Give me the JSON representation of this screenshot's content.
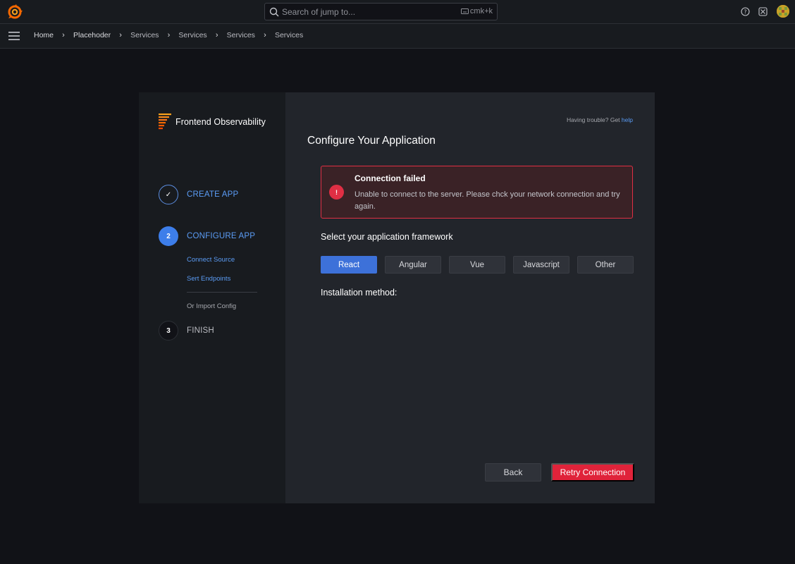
{
  "topbar": {
    "logo_icon": "grafana-logo-icon",
    "search_placeholder": "Search of jump to...",
    "search_shortcut": "cmk+k",
    "help_icon": "help-circle-icon",
    "close_icon": "close-box-icon",
    "avatar_icon": "user-avatar"
  },
  "breadcrumb": {
    "menu_icon": "hamburger-menu-icon",
    "items": [
      "Home",
      "Placehoder",
      "Services",
      "Services",
      "Services",
      "Services"
    ]
  },
  "sidebar": {
    "brand": "Frontend Observability",
    "steps": [
      {
        "marker": "✓",
        "label": "CREATE APP",
        "state": "done"
      },
      {
        "marker": "2",
        "label": "CONFIGURE APP",
        "state": "active",
        "substeps": [
          "Connect Source",
          "Sert Endpoints"
        ],
        "extra": "Or Import Config"
      },
      {
        "marker": "3",
        "label": "FINISH",
        "state": "pending"
      }
    ]
  },
  "panel": {
    "trouble_text": "Having trouble? Get",
    "trouble_link": "help",
    "title": "Configure Your Application",
    "alert": {
      "icon": "!",
      "title": "Connection failed",
      "message": "Unable to connect to the server. Please chck your network connection and try again."
    },
    "framework_label": "Select your application framework",
    "frameworks": [
      "React",
      "Angular",
      "Vue",
      "Javascript",
      "Other"
    ],
    "selected_framework": "React",
    "installation_label": "Installation method:",
    "back_label": "Back",
    "retry_label": "Retry Connection"
  },
  "colors": {
    "accent": "#3d71d9",
    "danger": "#e02f44",
    "background": "#111217"
  }
}
